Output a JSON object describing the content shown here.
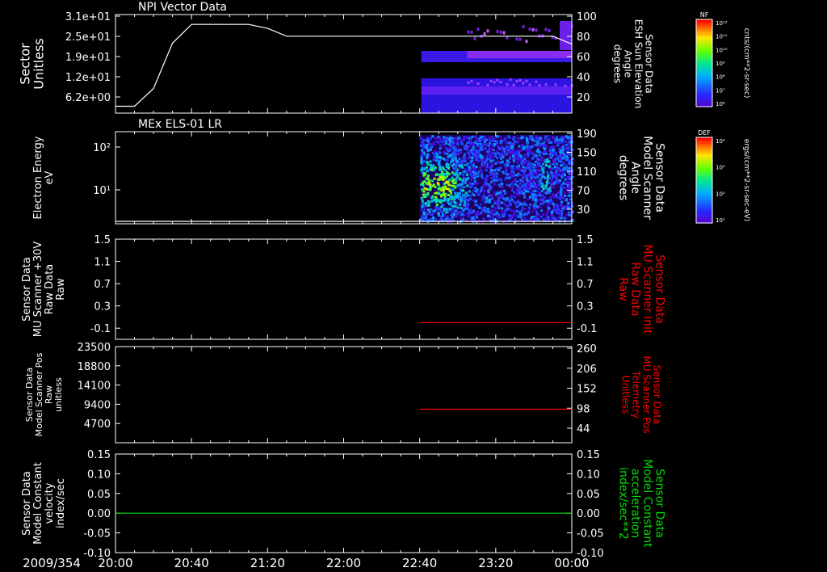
{
  "chart_data": {
    "type": "multi-panel time series",
    "x_ticks": [
      "20:00",
      "20:40",
      "21:20",
      "22:00",
      "22:40",
      "23:20",
      "00:00"
    ],
    "date_label": "2009/354",
    "panels": [
      {
        "id": "p1",
        "title": "NPI Vector Data",
        "left_label": [
          "Sector",
          "Unitless"
        ],
        "left_ticks": [
          "3.1e+01",
          "2.5e+01",
          "1.9e+01",
          "1.2e+01",
          "6.2e+00"
        ],
        "right_label": [
          "Sensor Data",
          "ESH Sun Elevation",
          "Angle",
          "degrees"
        ],
        "right_ticks": [
          "100",
          "80",
          "60",
          "40",
          "20"
        ],
        "colorbar": {
          "title": "NF",
          "unit": "cnts/(cm**2-sr-sec)",
          "ticks": [
            "10¹²",
            "10¹¹",
            "10¹⁰",
            "10⁹",
            "10⁸",
            "10⁷",
            "10⁶"
          ]
        },
        "line_color": "#ffffff",
        "line": {
          "x": [
            "20:00",
            "20:10",
            "20:20",
            "20:30",
            "20:40",
            "21:10",
            "21:20",
            "21:30",
            "22:40",
            "23:20",
            "23:50",
            "00:00"
          ],
          "y": [
            7,
            7,
            25,
            71,
            90,
            90,
            86,
            78,
            78,
            78,
            78,
            70
          ]
        }
      },
      {
        "id": "p2",
        "title": "MEx ELS-01 LR",
        "left_label": [
          "Electron Energy",
          "eV"
        ],
        "left_ticks": [
          "10²",
          "10¹"
        ],
        "right_label": [
          "Sensor Data",
          "Model Scanner",
          "Angle",
          "degrees"
        ],
        "right_ticks": [
          "190",
          "150",
          "110",
          "70",
          "30"
        ],
        "colorbar": {
          "title": "DEF",
          "unit": "ergs/(cm**2-sr-sec-eV)",
          "ticks": [
            "10⁴",
            "10³",
            "10²",
            "10¹"
          ]
        },
        "line_color": "#ffffff",
        "line": {
          "x": [
            "20:00",
            "00:00"
          ],
          "y": [
            10,
            10
          ]
        }
      },
      {
        "id": "p3",
        "left_label": [
          "Sensor Data",
          "MU Scanner +30V",
          "Raw Data",
          "Raw"
        ],
        "left_ticks": [
          "1.5",
          "1.1",
          "0.7",
          "0.3",
          "-0.1"
        ],
        "right_label": [
          "Sensor Data",
          "MU Scanner Init",
          "Raw Data",
          "Raw"
        ],
        "right_ticks": [
          "1.5",
          "1.1",
          "0.7",
          "0.3",
          "-0.1"
        ],
        "line_color": "#ff0000",
        "line": {
          "x": [
            "22:40",
            "00:00"
          ],
          "y": [
            0.0,
            0.0
          ]
        }
      },
      {
        "id": "p4",
        "left_label": [
          "Sensor Data",
          "Model Scanner Pos",
          "Raw",
          "unitless"
        ],
        "left_ticks": [
          "23500",
          "18800",
          "14100",
          "9400",
          "4700"
        ],
        "right_label": [
          "Sensor Data",
          "MU Scanner Pos",
          "Telemetry",
          "Unitless"
        ],
        "right_ticks": [
          "260",
          "206",
          "152",
          "98",
          "44"
        ],
        "line_color": "#ff0000",
        "line": {
          "x": [
            "22:40",
            "00:00"
          ],
          "y": [
            8200,
            8200
          ]
        }
      },
      {
        "id": "p5",
        "left_label": [
          "Sensor Data",
          "Model Constant",
          "velocity",
          "index/sec"
        ],
        "left_ticks": [
          "0.15",
          "0.10",
          "0.05",
          "0.00",
          "-0.05",
          "-0.10"
        ],
        "right_label": [
          "Sensor Data",
          "Model Constant",
          "acceleration",
          "index/sec**2"
        ],
        "right_ticks": [
          "0.15",
          "0.10",
          "0.05",
          "0.00",
          "-0.05",
          "-0.10"
        ],
        "line_color": "#00dd00",
        "line": {
          "x": [
            "20:00",
            "00:00"
          ],
          "y": [
            0.0,
            0.0
          ]
        }
      }
    ]
  },
  "colors": {
    "right_label_p3": "#ff0000",
    "right_label_p4": "#ff0000",
    "right_label_p5": "#00dd00"
  }
}
